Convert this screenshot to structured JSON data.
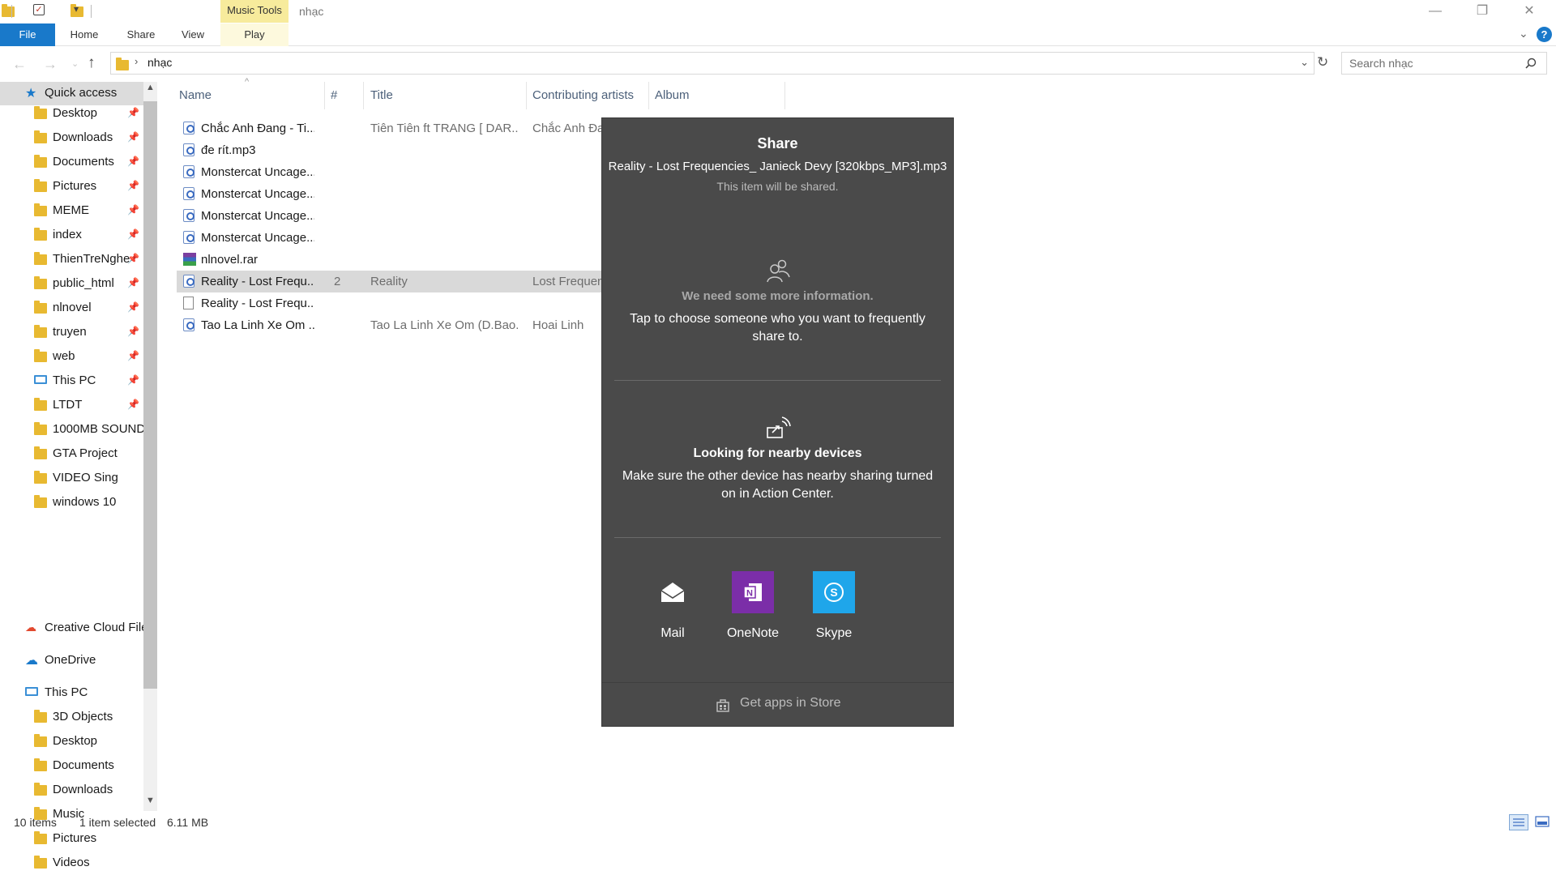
{
  "window": {
    "title": "nhạc",
    "contextual_tab_group": "Music Tools",
    "controls": {
      "minimize": "—",
      "maximize": "❐",
      "close": "✕"
    }
  },
  "ribbon": {
    "tabs": [
      {
        "label": "File"
      },
      {
        "label": "Home"
      },
      {
        "label": "Share"
      },
      {
        "label": "View"
      },
      {
        "label": "Play"
      }
    ],
    "collapse_icon": "chevron-down-icon",
    "help_icon": "help-icon"
  },
  "address": {
    "path": "nhạc",
    "search_placeholder": "Search nhạc"
  },
  "nav": {
    "quick_access": "Quick access",
    "items": [
      {
        "label": "Desktop",
        "icon": "desktop-folder-icon"
      },
      {
        "label": "Downloads",
        "icon": "downloads-folder-icon"
      },
      {
        "label": "Documents",
        "icon": "documents-folder-icon"
      },
      {
        "label": "Pictures",
        "icon": "pictures-folder-icon"
      },
      {
        "label": "MEME",
        "icon": "folder-icon"
      },
      {
        "label": "index",
        "icon": "folder-icon"
      },
      {
        "label": "ThienTreNghe",
        "icon": "folder-icon"
      },
      {
        "label": "public_html",
        "icon": "folder-icon"
      },
      {
        "label": "nlnovel",
        "icon": "folder-icon"
      },
      {
        "label": "truyen",
        "icon": "folder-icon"
      },
      {
        "label": "web",
        "icon": "folder-icon"
      },
      {
        "label": "This PC",
        "icon": "computer-icon"
      },
      {
        "label": "LTDT",
        "icon": "folder-icon"
      },
      {
        "label": "1000MB SOUND",
        "icon": "folder-icon"
      },
      {
        "label": "GTA Project",
        "icon": "folder-icon"
      },
      {
        "label": "VIDEO Sing",
        "icon": "folder-icon"
      },
      {
        "label": "windows 10",
        "icon": "folder-icon"
      }
    ],
    "creative_cloud": "Creative Cloud File",
    "onedrive": "OneDrive",
    "this_pc": "This PC",
    "pc_items": [
      {
        "label": "3D Objects"
      },
      {
        "label": "Desktop"
      },
      {
        "label": "Documents"
      },
      {
        "label": "Downloads"
      },
      {
        "label": "Music"
      },
      {
        "label": "Pictures"
      },
      {
        "label": "Videos"
      }
    ]
  },
  "columns": {
    "name": "Name",
    "number": "#",
    "title": "Title",
    "artists": "Contributing artists",
    "album": "Album"
  },
  "files": [
    {
      "name": "Chắc Anh Đang - Ti...",
      "num": "",
      "title": "Tiên Tiên ft TRANG [ DAR...",
      "artist": "Chắc Anh Đa"
    },
    {
      "name": "đe rít.mp3",
      "num": "",
      "title": "",
      "artist": ""
    },
    {
      "name": "Monstercat Uncage...",
      "num": "",
      "title": "",
      "artist": ""
    },
    {
      "name": "Monstercat Uncage...",
      "num": "",
      "title": "",
      "artist": ""
    },
    {
      "name": "Monstercat Uncage...",
      "num": "",
      "title": "",
      "artist": ""
    },
    {
      "name": "Monstercat Uncage...",
      "num": "",
      "title": "",
      "artist": ""
    },
    {
      "name": "nlnovel.rar",
      "num": "",
      "title": "",
      "artist": ""
    },
    {
      "name": "Reality - Lost Frequ...",
      "num": "2",
      "title": "Reality",
      "artist": "Lost Frequen"
    },
    {
      "name": "Reality - Lost Frequ...",
      "num": "",
      "title": "",
      "artist": ""
    },
    {
      "name": "Tao La Linh Xe Om ...",
      "num": "",
      "title": "Tao La Linh Xe Om (D.Bao...",
      "artist": "Hoai Linh"
    }
  ],
  "selected_row": 7,
  "status": {
    "count": "10 items",
    "selected": "1 item selected",
    "size": "6.11 MB"
  },
  "share": {
    "title": "Share",
    "filename": "Reality - Lost Frequencies_ Janieck Devy [320kbps_MP3].mp3",
    "subtitle": "This item will be shared.",
    "more_info": "We need some more information.",
    "tap_choose": "Tap to choose someone who you want to frequently share to.",
    "nearby_title": "Looking for nearby devices",
    "nearby_desc": "Make sure the other device has nearby sharing turned on in Action Center.",
    "apps": [
      {
        "label": "Mail",
        "color": "#4a4a4a"
      },
      {
        "label": "OneNote",
        "color": "#7b2ea8"
      },
      {
        "label": "Skype",
        "color": "#1fa6ea"
      }
    ],
    "store": "Get apps in Store"
  },
  "colors": {
    "accent": "#1979ca",
    "share_bg": "#4a4a4a",
    "music_tools": "#f7eb9c",
    "selection": "#d9d9d9"
  }
}
